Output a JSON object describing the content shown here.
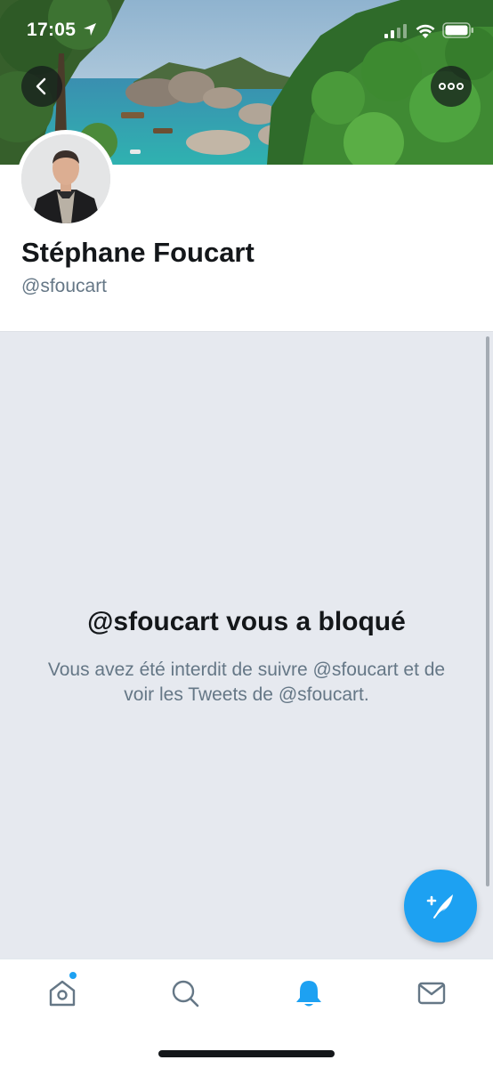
{
  "status_bar": {
    "time": "17:05",
    "icons": [
      "location-arrow-icon",
      "signal-icon",
      "wifi-icon",
      "battery-icon"
    ]
  },
  "banner": {
    "description_icon": "coastal-landscape-image"
  },
  "navigation": {
    "back_icon": "chevron-left-icon",
    "more_icon": "more-horizontal-icon"
  },
  "profile": {
    "display_name": "Stéphane Foucart",
    "handle": "@sfoucart"
  },
  "blocked": {
    "title": "@sfoucart vous a bloqué",
    "description": "Vous avez été interdit de suivre @sfoucart et de voir les Tweets de @sfoucart."
  },
  "compose": {
    "icon": "compose-feather-icon"
  },
  "tab_bar": {
    "tabs": [
      {
        "name": "home",
        "icon": "home-icon",
        "has_notification_dot": true,
        "active": false
      },
      {
        "name": "search",
        "icon": "search-icon",
        "active": false
      },
      {
        "name": "notifications",
        "icon": "bell-icon",
        "active": true
      },
      {
        "name": "messages",
        "icon": "mail-icon",
        "active": false
      }
    ]
  },
  "colors": {
    "accent": "#1da1f2",
    "panel_background": "#e6e9ef",
    "secondary_text": "#657786",
    "primary_text": "#14171a"
  }
}
